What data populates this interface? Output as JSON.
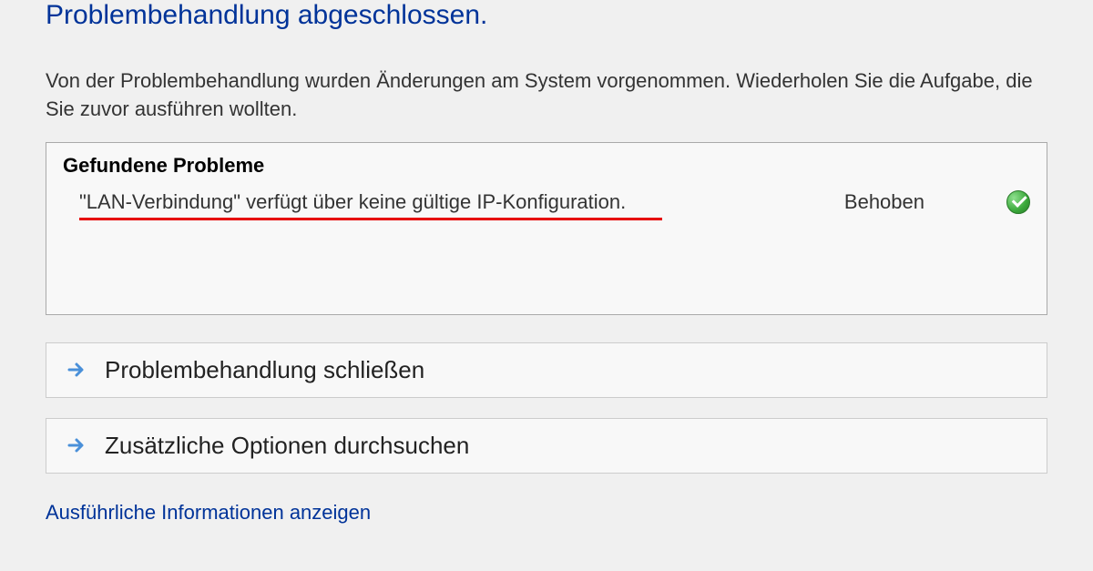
{
  "heading": "Problembehandlung abgeschlossen.",
  "description": "Von der Problembehandlung wurden Änderungen am System vorgenommen. Wiederholen Sie die Aufgabe, die Sie zuvor ausführen wollten.",
  "problems": {
    "header": "Gefundene Probleme",
    "items": [
      {
        "text": "\"LAN-Verbindung\" verfügt über keine gültige IP-Konfiguration.",
        "status": "Behoben"
      }
    ]
  },
  "options": [
    {
      "label": "Problembehandlung schließen"
    },
    {
      "label": "Zusätzliche Optionen durchsuchen"
    }
  ],
  "bottomLink": "Ausführliche Informationen anzeigen"
}
